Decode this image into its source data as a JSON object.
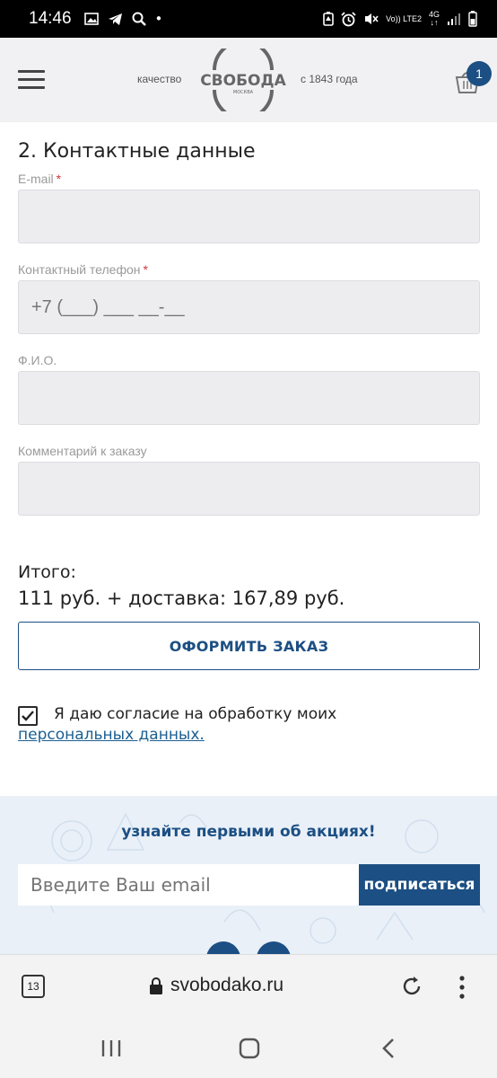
{
  "status_bar": {
    "time": "14:46",
    "network": "Vo)) LTE2",
    "network_gen": "4G"
  },
  "header": {
    "brand_tag_left": "качество",
    "brand_name": "СВОБОДА",
    "brand_city": "МОСКВА",
    "brand_tag_right": "с 1843 года",
    "cart_count": "1"
  },
  "form": {
    "section_title": "2. Контактные данные",
    "email": {
      "label": "E-mail",
      "required_mark": "*",
      "value": ""
    },
    "phone": {
      "label": "Контактный телефон",
      "required_mark": "*",
      "placeholder": "+7 (___) ___ __-__"
    },
    "name": {
      "label": "Ф.И.О.",
      "value": ""
    },
    "comment": {
      "label": "Комментарий к заказу",
      "value": ""
    }
  },
  "order": {
    "total_label": "Итого:",
    "total_value": "111 руб. + доставка: 167,89 руб.",
    "submit_label": "ОФОРМИТЬ ЗАКАЗ",
    "consent_checked": true,
    "consent_text": "Я даю согласие на обработку моих",
    "consent_link": "персональных данных."
  },
  "subscribe": {
    "title": "узнайте первыми об акциях!",
    "placeholder": "Введите Ваш email",
    "button_label": "подписаться"
  },
  "browser": {
    "tab_count": "13",
    "url": "svobodako.ru"
  },
  "colors": {
    "brand_blue": "#1c4f83",
    "field_bg": "#ededf0",
    "required_red": "#d0353a"
  }
}
